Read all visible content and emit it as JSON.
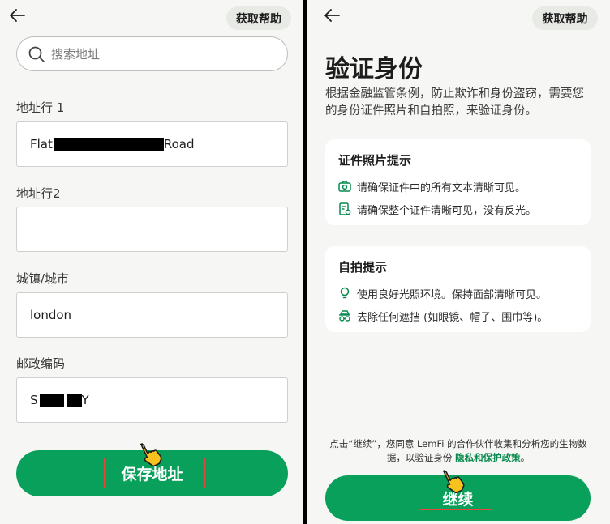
{
  "left": {
    "help_label": "获取帮助",
    "search": {
      "placeholder": "搜索地址"
    },
    "fields": [
      {
        "label": "地址行 1",
        "value_prefix": "Flat",
        "value_suffix": "Road"
      },
      {
        "label": "地址行2",
        "value": ""
      },
      {
        "label": "城镇/城市",
        "value": "london"
      },
      {
        "label": "邮政编码",
        "value_prefix": "S",
        "value_suffix": "Y"
      }
    ],
    "save_label": "保存地址"
  },
  "right": {
    "help_label": "获取帮助",
    "title": "验证身份",
    "description": "根据金融监管条例，防止欺诈和身份盗窃，需要您的身份证件照片和自拍照，来验证身份。",
    "id_card": {
      "title": "证件照片提示",
      "tips": [
        "请确保证件中的所有文本清晰可见。",
        "请确保整个证件清晰可见，没有反光。"
      ]
    },
    "selfie_card": {
      "title": "自拍提示",
      "tips": [
        "使用良好光照环境。保持面部清晰可见。",
        "去除任何遮挡 (如眼镜、帽子、围巾等)。"
      ]
    },
    "consent_text": "点击“继续”，您同意 LemFi 的合作伙伴收集和分析您的生物数据，以验证身份",
    "consent_link": "隐私和保护政策",
    "consent_end": "。",
    "continue_label": "继续"
  },
  "colors": {
    "brand_green": "#08a05a",
    "highlight": "#e8453c",
    "cursor": "#f7c21e"
  }
}
